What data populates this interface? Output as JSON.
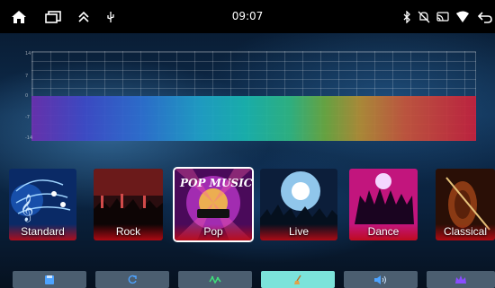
{
  "status_bar": {
    "time": "09:07",
    "left_icons": [
      "home-icon",
      "recent-apps-icon",
      "expand-up-icon",
      "usb-icon"
    ],
    "right_icons": [
      "bluetooth-icon",
      "notifications-muted-icon",
      "cast-icon",
      "wifi-icon",
      "back-icon"
    ]
  },
  "equalizer": {
    "scale_labels": [
      "14",
      "7",
      "0",
      "-7",
      "-14"
    ]
  },
  "presets": [
    {
      "label": "Standard"
    },
    {
      "label": "Rock"
    },
    {
      "label": "Pop",
      "selected": true
    },
    {
      "label": "Live"
    },
    {
      "label": "Dance"
    },
    {
      "label": "Classical"
    }
  ],
  "bottom_bar": {
    "buttons": [
      "save-icon",
      "reset-icon",
      "equalizer-icon",
      "broom-icon",
      "volume-icon",
      "crown-icon"
    ],
    "active": "broom-icon"
  },
  "colors": {
    "active_tab": "#7be3da",
    "tab": "#4b5e70",
    "statusbar": "#000000"
  }
}
